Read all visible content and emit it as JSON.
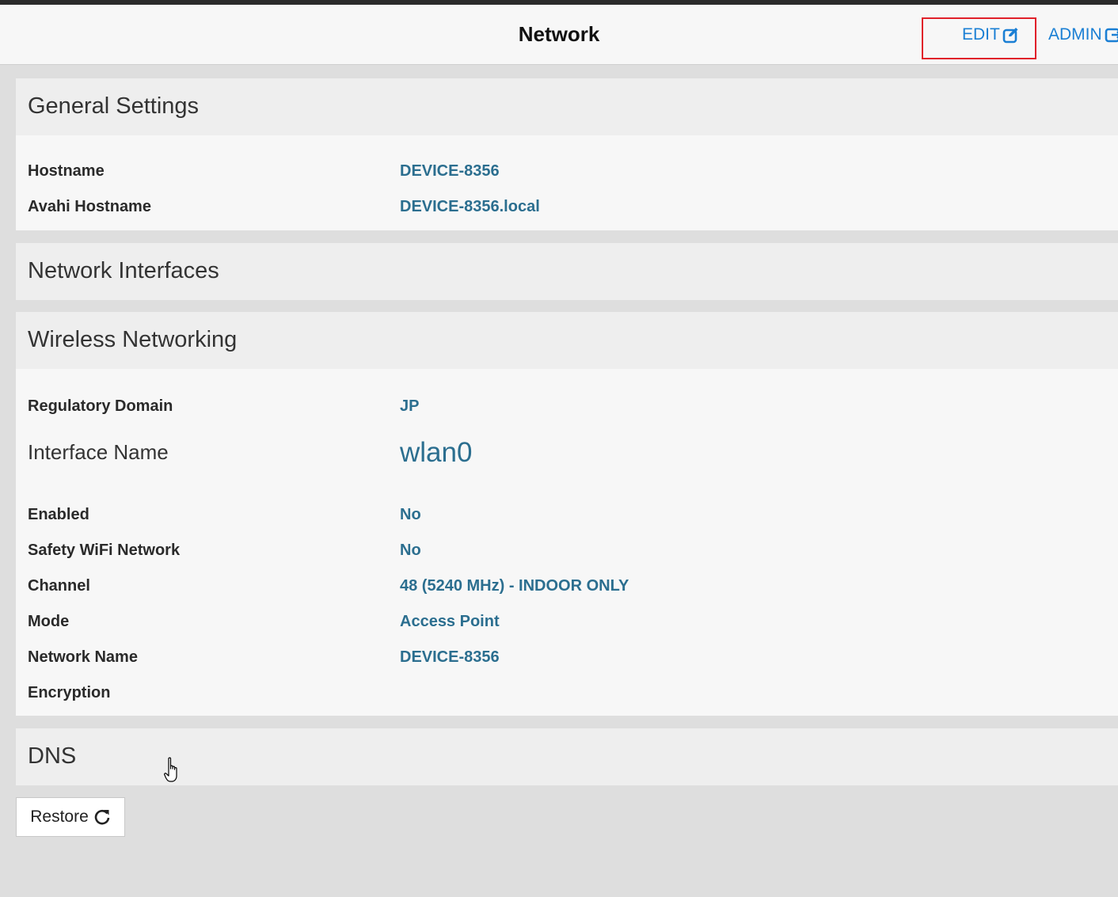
{
  "header": {
    "title": "Network",
    "edit_label": "EDIT",
    "admin_label": "ADMIN",
    "edit_icon": "edit-icon",
    "admin_icon": "admin-icon",
    "link_color": "#1a7fd4",
    "highlight_color": "#e0202a"
  },
  "general_settings": {
    "title": "General Settings",
    "rows": [
      {
        "label": "Hostname",
        "value": "DEVICE-8356"
      },
      {
        "label": "Avahi Hostname",
        "value": "DEVICE-8356.local"
      }
    ]
  },
  "network_interfaces": {
    "title": "Network Interfaces"
  },
  "wireless": {
    "title": "Wireless Networking",
    "regulatory_domain": {
      "label": "Regulatory Domain",
      "value": "JP"
    },
    "interface": {
      "label": "Interface Name",
      "value": "wlan0"
    },
    "rows": [
      {
        "label": "Enabled",
        "value": "No"
      },
      {
        "label": "Safety WiFi Network",
        "value": "No"
      },
      {
        "label": "Channel",
        "value": "48 (5240 MHz) - INDOOR ONLY"
      },
      {
        "label": "Mode",
        "value": "Access Point"
      },
      {
        "label": "Network Name",
        "value": "DEVICE-8356"
      },
      {
        "label": "Encryption",
        "value": ""
      }
    ]
  },
  "dns": {
    "title": "DNS"
  },
  "restore": {
    "label": "Restore",
    "icon": "refresh-icon"
  },
  "colors": {
    "value_text": "#2b6e8f",
    "label_text": "#2a2a2a",
    "section_head_bg": "#eeeeee",
    "page_bg": "#dedede"
  }
}
